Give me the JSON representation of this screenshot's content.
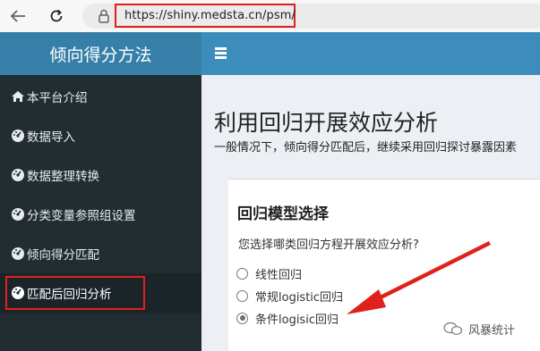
{
  "browser": {
    "url": "https://shiny.medsta.cn/psm/"
  },
  "sidebar": {
    "title": "倾向得分方法",
    "items": [
      {
        "label": "本平台介绍",
        "icon": "home-icon"
      },
      {
        "label": "数据导入",
        "icon": "dashboard-icon"
      },
      {
        "label": "数据整理转换",
        "icon": "dashboard-icon"
      },
      {
        "label": "分类变量参照组设置",
        "icon": "dashboard-icon"
      },
      {
        "label": "倾向得分匹配",
        "icon": "dashboard-icon"
      },
      {
        "label": "匹配后回归分析",
        "icon": "dashboard-icon",
        "active": true
      }
    ]
  },
  "main": {
    "title": "利用回归开展效应分析",
    "description": "一般情况下，倾向得分匹配后，继续采用回归探讨暴露因素",
    "box": {
      "title": "回归模型选择",
      "question": "您选择哪类回归方程开展效应分析?",
      "options": [
        {
          "label": "线性回归",
          "checked": false
        },
        {
          "label": "常规logistic回归",
          "checked": false
        },
        {
          "label": "条件logisic回归",
          "checked": true
        }
      ]
    }
  },
  "watermark": {
    "text": "风暴统计"
  },
  "colors": {
    "sidebar_bg": "#222d32",
    "sidebar_header": "#367fa9",
    "topbar": "#3c8dbc",
    "highlight_red": "#e0201b"
  }
}
